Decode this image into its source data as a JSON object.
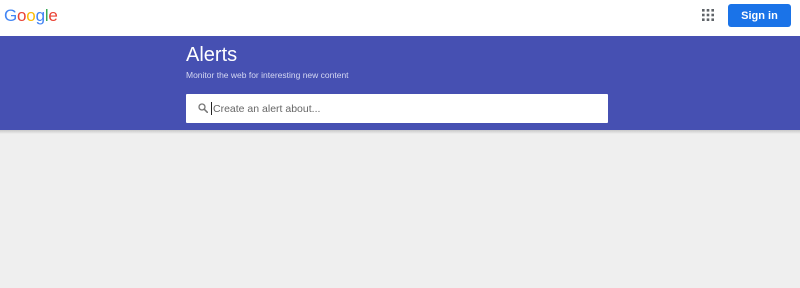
{
  "header": {
    "logo_letters": [
      {
        "char": "G",
        "color": "#4285f4"
      },
      {
        "char": "o",
        "color": "#ea4335"
      },
      {
        "char": "o",
        "color": "#fbbc05"
      },
      {
        "char": "g",
        "color": "#4285f4"
      },
      {
        "char": "l",
        "color": "#34a853"
      },
      {
        "char": "e",
        "color": "#ea4335"
      }
    ],
    "apps_icon": "grid-apps-icon",
    "signin_label": "Sign in",
    "signin_color": "#1a73e8"
  },
  "banner": {
    "title": "Alerts",
    "subtitle": "Monitor the web for interesting new content",
    "background": "#4650b2"
  },
  "search": {
    "icon": "search-icon",
    "placeholder": "Create an alert about...",
    "value": ""
  },
  "colors": {
    "page_background": "#efefef"
  }
}
